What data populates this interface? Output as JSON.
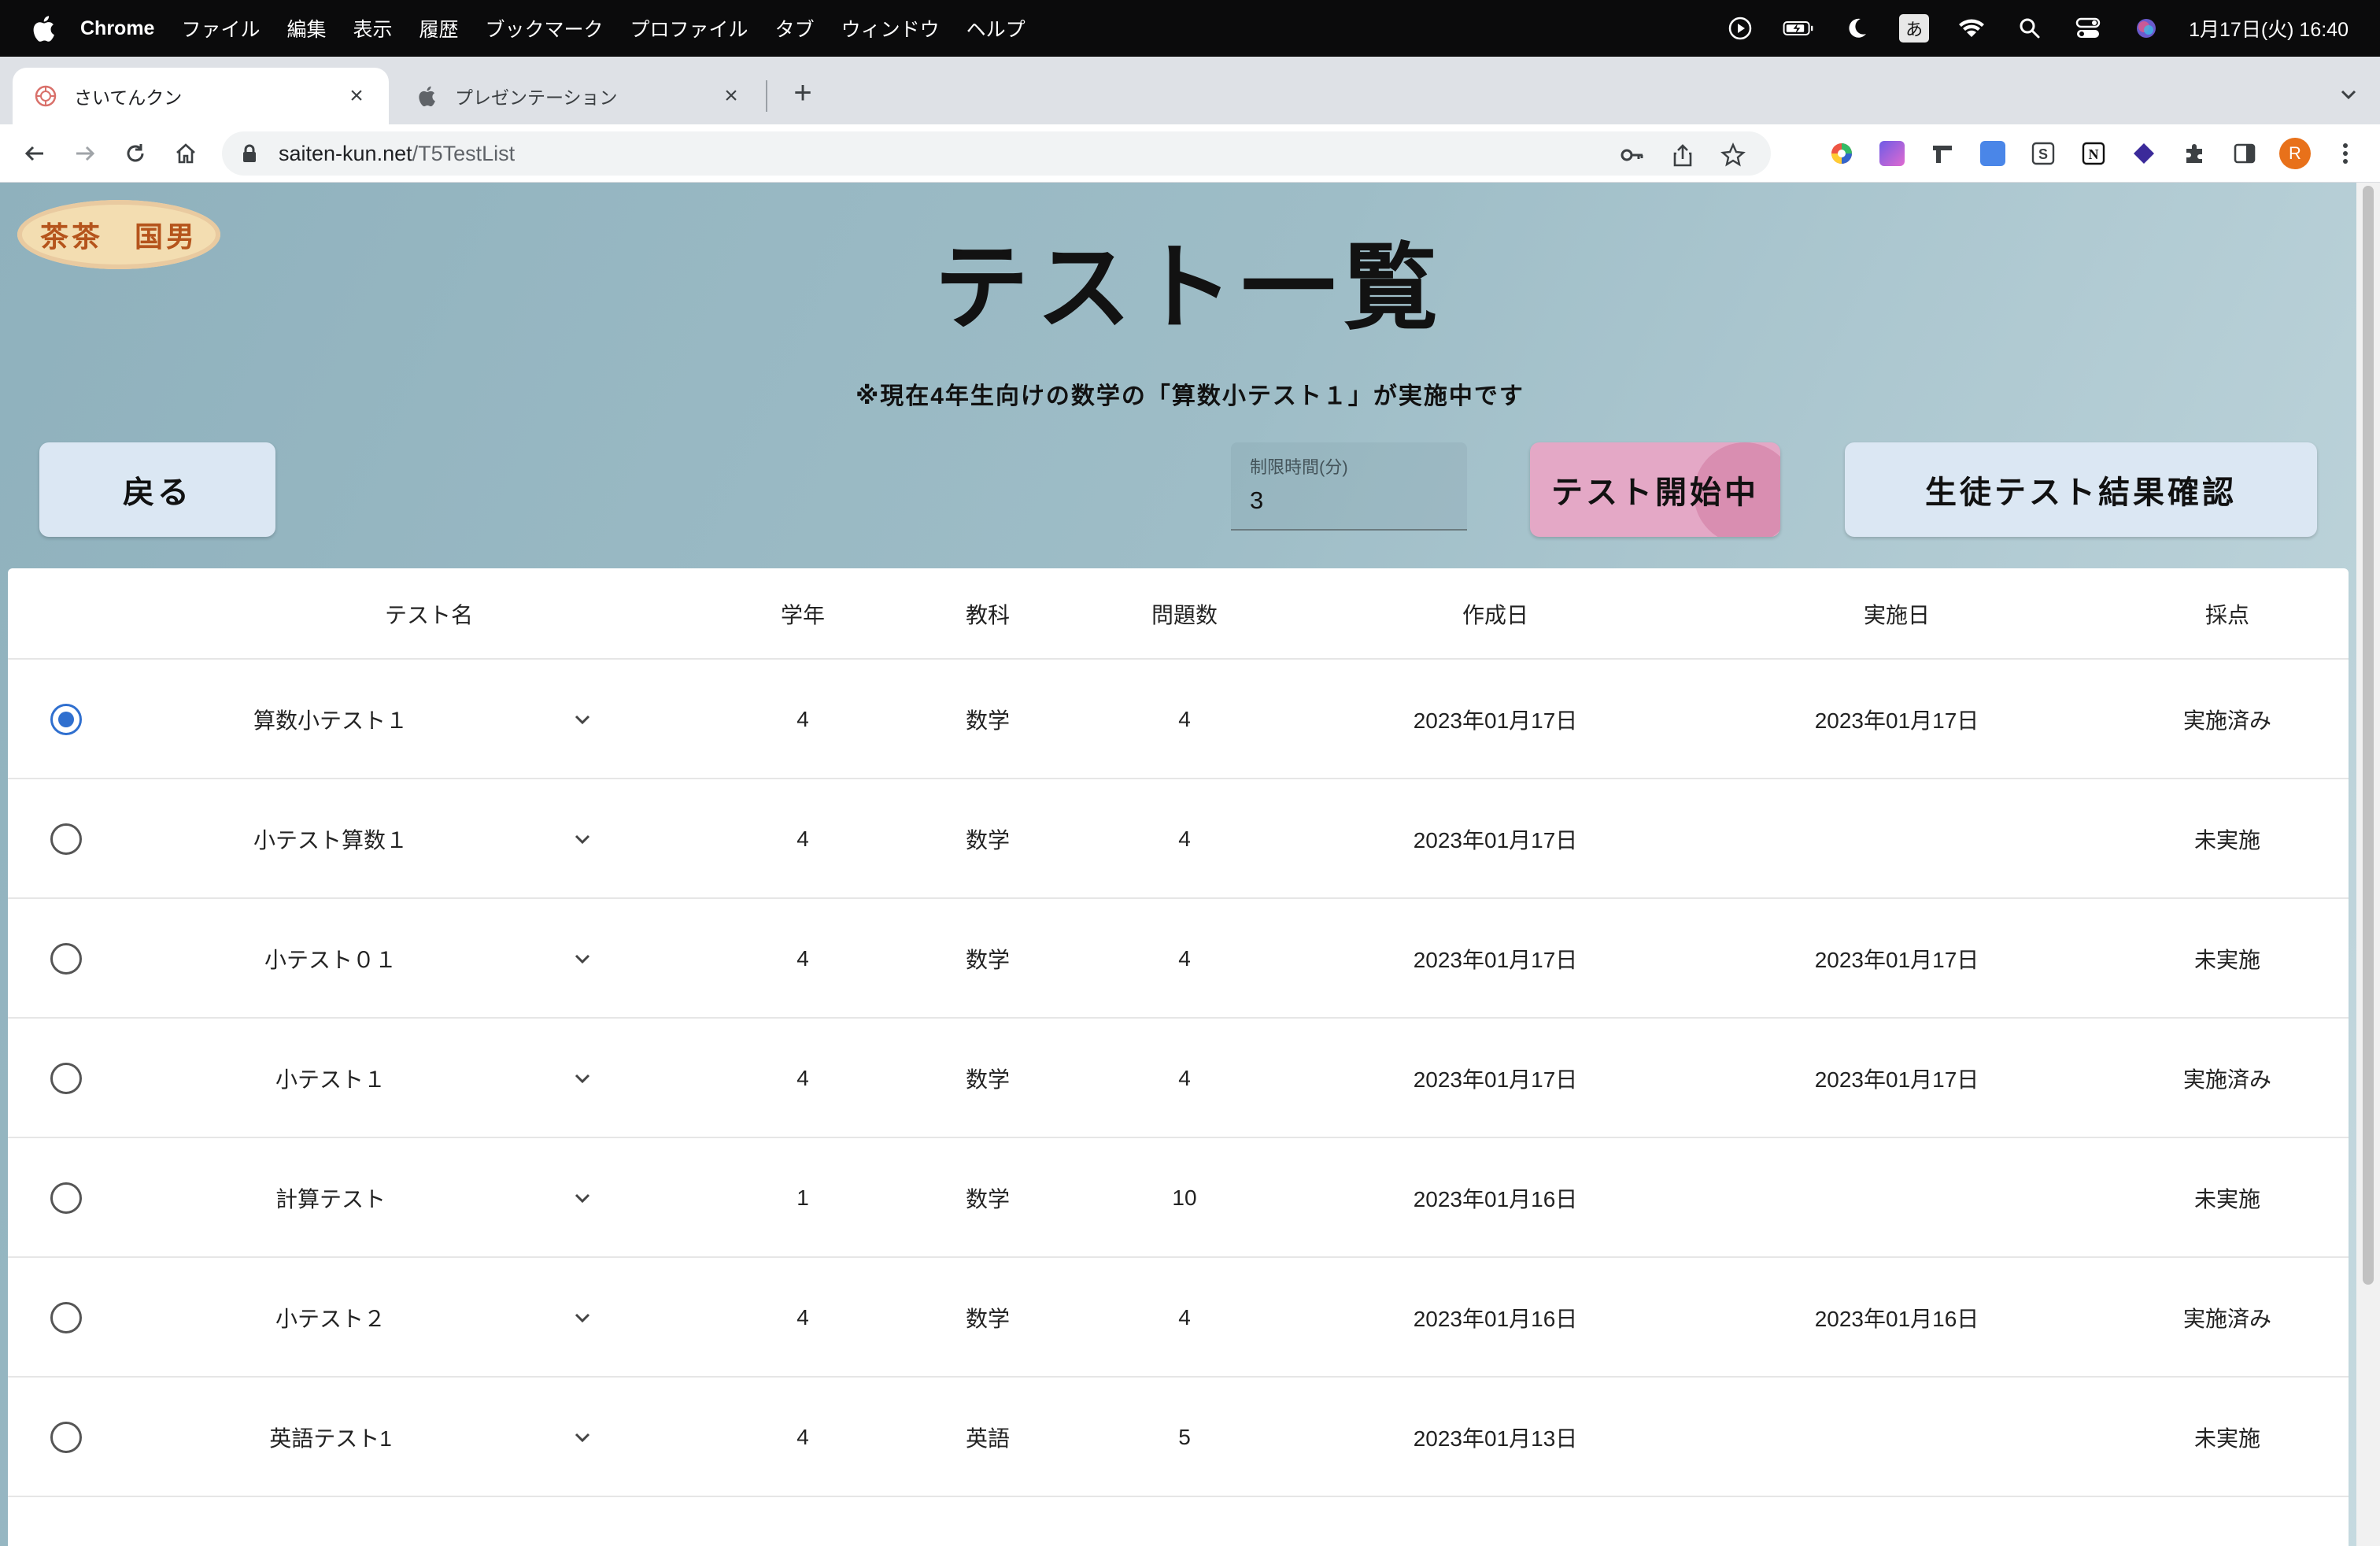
{
  "menubar": {
    "app_name": "Chrome",
    "items": [
      "ファイル",
      "編集",
      "表示",
      "履歴",
      "ブックマーク",
      "プロファイル",
      "タブ",
      "ウィンドウ",
      "ヘルプ"
    ],
    "ime": "あ",
    "clock": "1月17日(火) 16:40"
  },
  "tabs": [
    {
      "title": "さいてんクン"
    },
    {
      "title": "プレゼンテーション"
    }
  ],
  "omnibox": {
    "host": "saiten-kun.net",
    "path": "/T5TestList"
  },
  "profile": {
    "initial": "R"
  },
  "page": {
    "user_name": "茶茶　国男",
    "title": "テスト一覧",
    "notice": "※現在4年生向けの数学の「算数小テスト１」が実施中です",
    "back_button": "戻る",
    "time_limit": {
      "label": "制限時間(分)",
      "value": "3"
    },
    "start_button": "テスト開始中",
    "results_button": "生徒テスト結果確認"
  },
  "table": {
    "headers": {
      "name": "テスト名",
      "grade": "学年",
      "subject": "教科",
      "count": "問題数",
      "created": "作成日",
      "held": "実施日",
      "scoring": "採点"
    },
    "rows": [
      {
        "selected": true,
        "name": "算数小テスト１",
        "grade": "4",
        "subject": "数学",
        "count": "4",
        "created": "2023年01月17日",
        "held": "2023年01月17日",
        "scoring": "実施済み"
      },
      {
        "selected": false,
        "name": "小テスト算数１",
        "grade": "4",
        "subject": "数学",
        "count": "4",
        "created": "2023年01月17日",
        "held": "",
        "scoring": "未実施"
      },
      {
        "selected": false,
        "name": "小テスト０１",
        "grade": "4",
        "subject": "数学",
        "count": "4",
        "created": "2023年01月17日",
        "held": "2023年01月17日",
        "scoring": "未実施"
      },
      {
        "selected": false,
        "name": "小テスト１",
        "grade": "4",
        "subject": "数学",
        "count": "4",
        "created": "2023年01月17日",
        "held": "2023年01月17日",
        "scoring": "実施済み"
      },
      {
        "selected": false,
        "name": "計算テスト",
        "grade": "1",
        "subject": "数学",
        "count": "10",
        "created": "2023年01月16日",
        "held": "",
        "scoring": "未実施"
      },
      {
        "selected": false,
        "name": "小テスト２",
        "grade": "4",
        "subject": "数学",
        "count": "4",
        "created": "2023年01月16日",
        "held": "2023年01月16日",
        "scoring": "実施済み"
      },
      {
        "selected": false,
        "name": "英語テスト1",
        "grade": "4",
        "subject": "英語",
        "count": "5",
        "created": "2023年01月13日",
        "held": "",
        "scoring": "未実施"
      }
    ]
  }
}
